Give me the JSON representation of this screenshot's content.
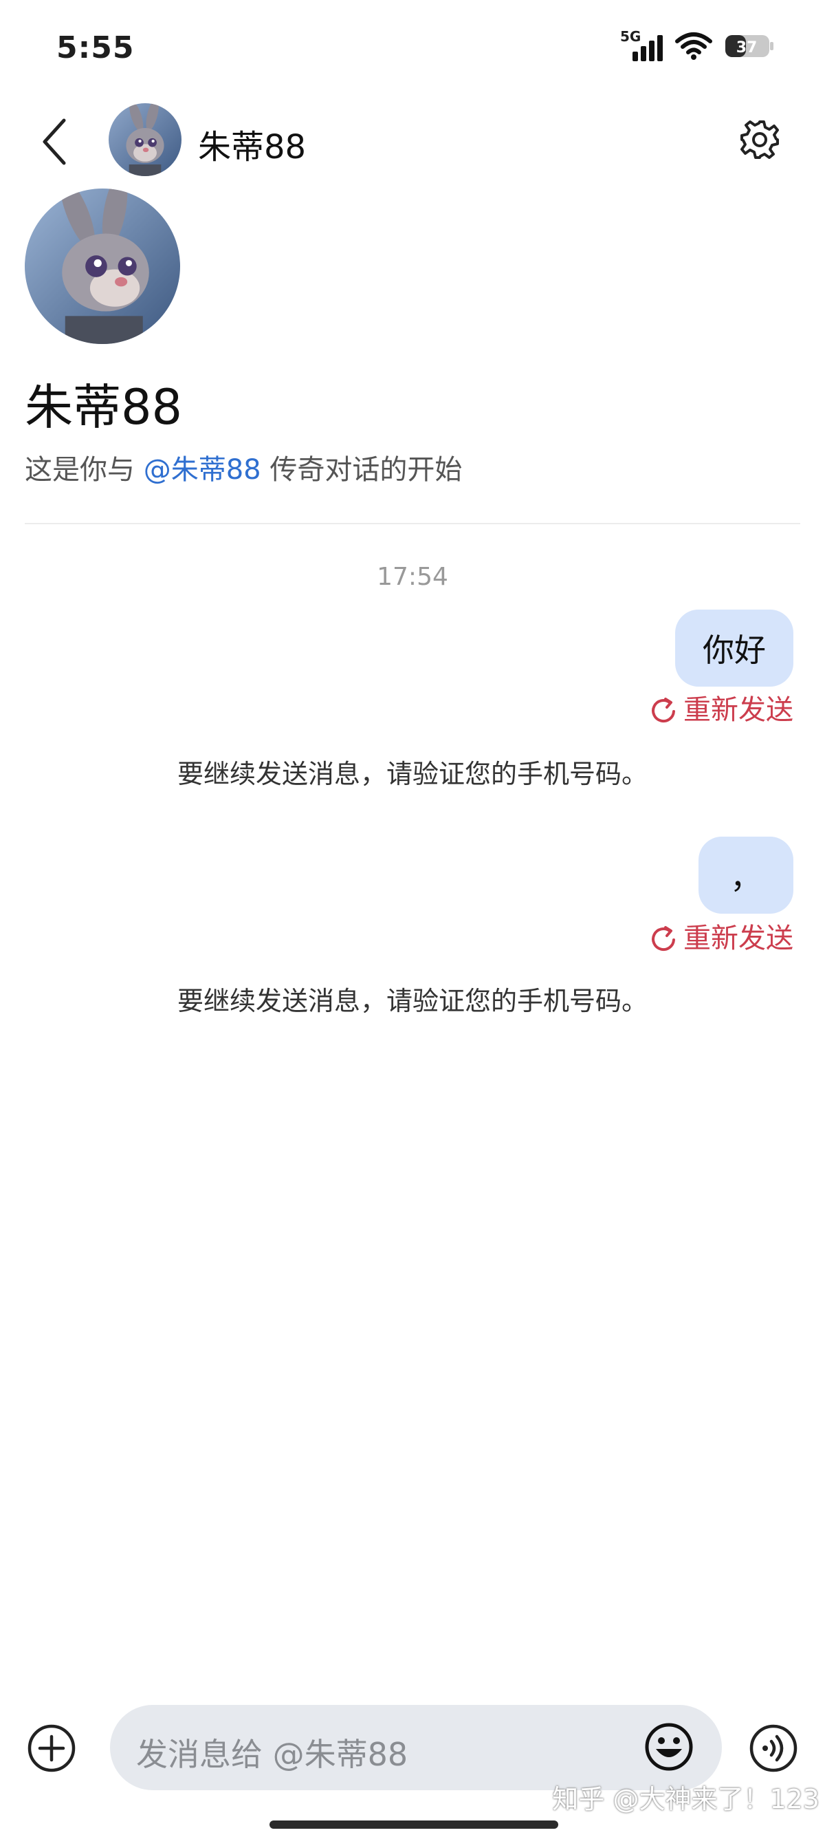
{
  "status_bar": {
    "time": "5:55",
    "network": "5G",
    "battery": "37"
  },
  "header": {
    "contact_name": "朱蒂88"
  },
  "intro": {
    "name": "朱蒂88",
    "text_prefix": "这是你与 ",
    "mention": "@朱蒂88",
    "text_suffix": " 传奇对话的开始"
  },
  "conversation": {
    "timestamp": "17:54",
    "messages": [
      {
        "text": "你好",
        "resend_label": "重新发送",
        "warning": "要继续发送消息，请验证您的手机号码。"
      },
      {
        "text": "，",
        "resend_label": "重新发送",
        "warning": "要继续发送消息，请验证您的手机号码。"
      }
    ]
  },
  "composer": {
    "placeholder": "发消息给  @朱蒂88"
  },
  "watermark": "知乎 @大神来了！123",
  "colors": {
    "bubble": "#d6e4fb",
    "resend": "#cc3d4d",
    "mention": "#2f6fd0",
    "input_bg": "#e6e9ee"
  },
  "icons": [
    "back-arrow-icon",
    "settings-gear-icon",
    "retry-icon",
    "add-circle-icon",
    "emoji-icon",
    "voice-icon"
  ]
}
